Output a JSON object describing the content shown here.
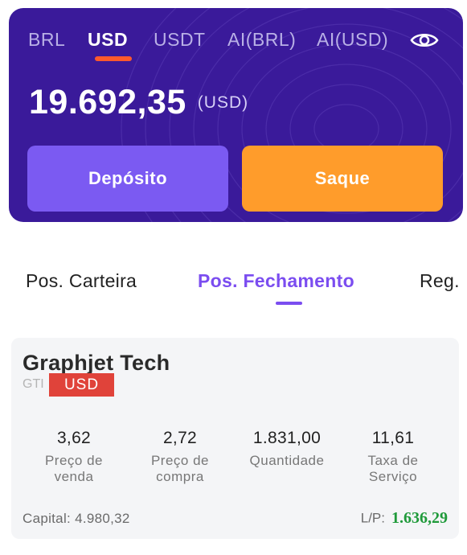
{
  "account_card": {
    "currency_tabs": [
      {
        "label": "BRL"
      },
      {
        "label": "USD"
      },
      {
        "label": "USDT"
      },
      {
        "label": "AI(BRL)"
      },
      {
        "label": "AI(USD)"
      }
    ],
    "active_currency_index": 1,
    "balance": {
      "value": "19.692,35",
      "unit": "(USD)"
    },
    "buttons": {
      "deposit_label": "Depósito",
      "withdraw_label": "Saque"
    },
    "colors": {
      "card_bg": "#3a1a9a",
      "deposit_bg": "#7b5af2",
      "withdraw_bg": "#ff9c2b",
      "tab_indicator": "#ff5a2c"
    }
  },
  "position_tabs": {
    "items": [
      {
        "label": "Pos. Carteira"
      },
      {
        "label": "Pos. Fechamento"
      },
      {
        "label": "Reg."
      }
    ],
    "active_index": 1,
    "accent": "#7b4df0"
  },
  "position": {
    "name": "Graphjet Tech",
    "code": "GTI",
    "currency_badge": "USD",
    "stats": [
      {
        "value": "3,62",
        "label_line1": "Preço de",
        "label_line2": "venda"
      },
      {
        "value": "2,72",
        "label_line1": "Preço de",
        "label_line2": "compra"
      },
      {
        "value": "1.831,00",
        "label_line1": "Quantidade",
        "label_line2": ""
      },
      {
        "value": "11,61",
        "label_line1": "Taxa de",
        "label_line2": "Serviço"
      }
    ],
    "capital": {
      "label": "Capital:",
      "value": "4.980,32"
    },
    "pl": {
      "label": "L/P:",
      "value": "1.636,29",
      "color": "#1f9a3a"
    }
  }
}
